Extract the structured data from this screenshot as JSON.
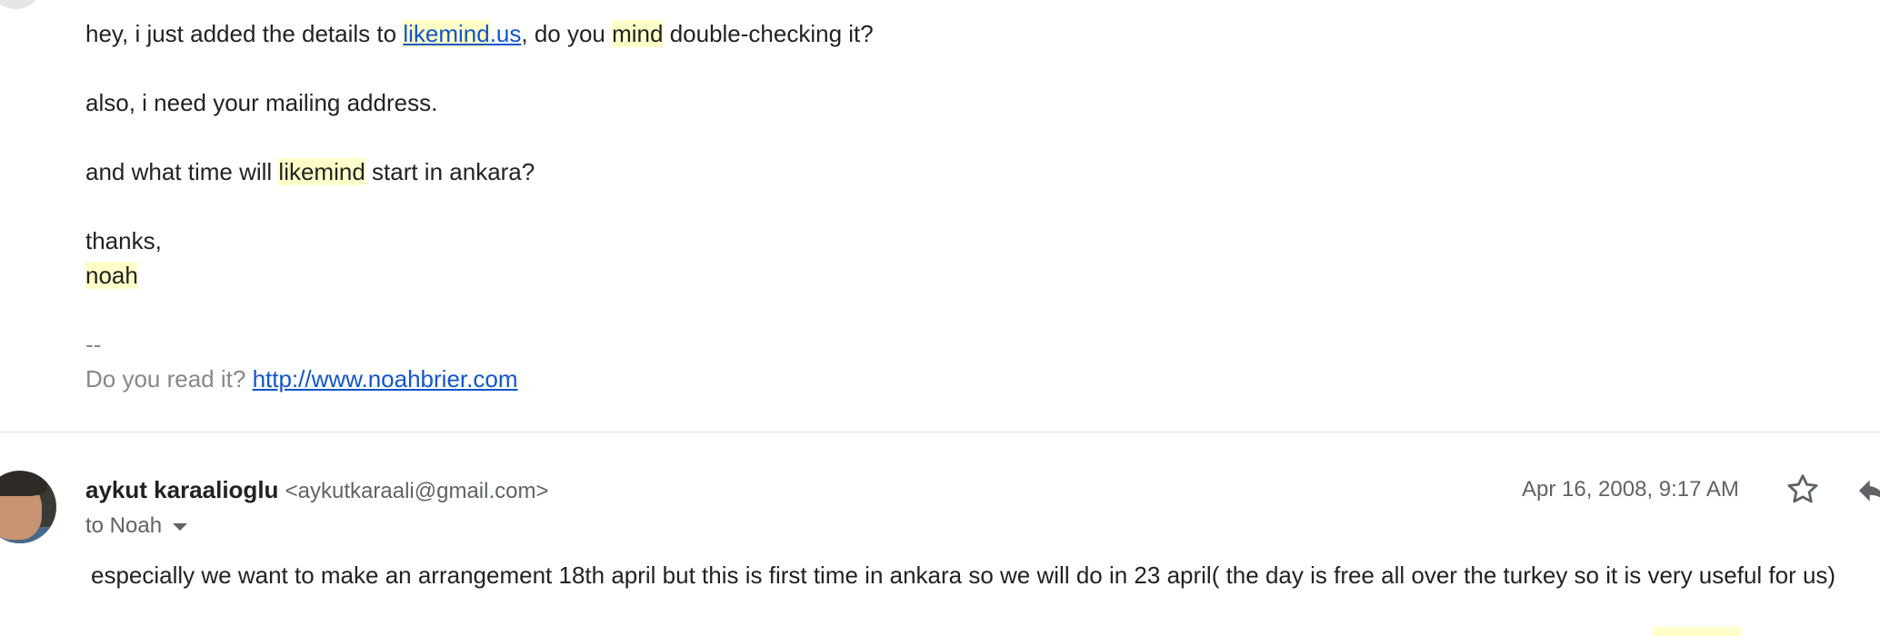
{
  "previous_message": {
    "line1": {
      "before": "hey, i just added the details to ",
      "link_part1": "likemind",
      "link_part2": ".us",
      "mid": ", do you ",
      "hl_word": "mind",
      "after": " double-checking it?"
    },
    "line2": "also, i need your mailing address.",
    "line3": {
      "before": "and what time will ",
      "hl_word": "likemind",
      "after": " start in ankara?"
    },
    "signoff": "thanks,",
    "name": "noah",
    "sig_dash": "--",
    "sig_prefix": "Do you read it? ",
    "sig_link": "http://www.noahbrier.com"
  },
  "message": {
    "sender_name": "aykut karaalioglu",
    "sender_email": "<aykutkaraali@gmail.com>",
    "recipient": "to Noah",
    "date": "Apr 16, 2008, 9:17 AM",
    "body": "especially we want to make an arrangement 18th april but this is first time in ankara so we will do in 23 april( the day is free all over the turkey so it is very useful for us)"
  },
  "icons": {
    "star": "star-outline-icon",
    "reply": "reply-arrow-icon",
    "dropdown": "chevron-down-icon"
  },
  "colors": {
    "highlight": "#ffffc9",
    "link": "#1155cc",
    "secondary_text": "#5f6368",
    "signature_text": "#888888"
  }
}
